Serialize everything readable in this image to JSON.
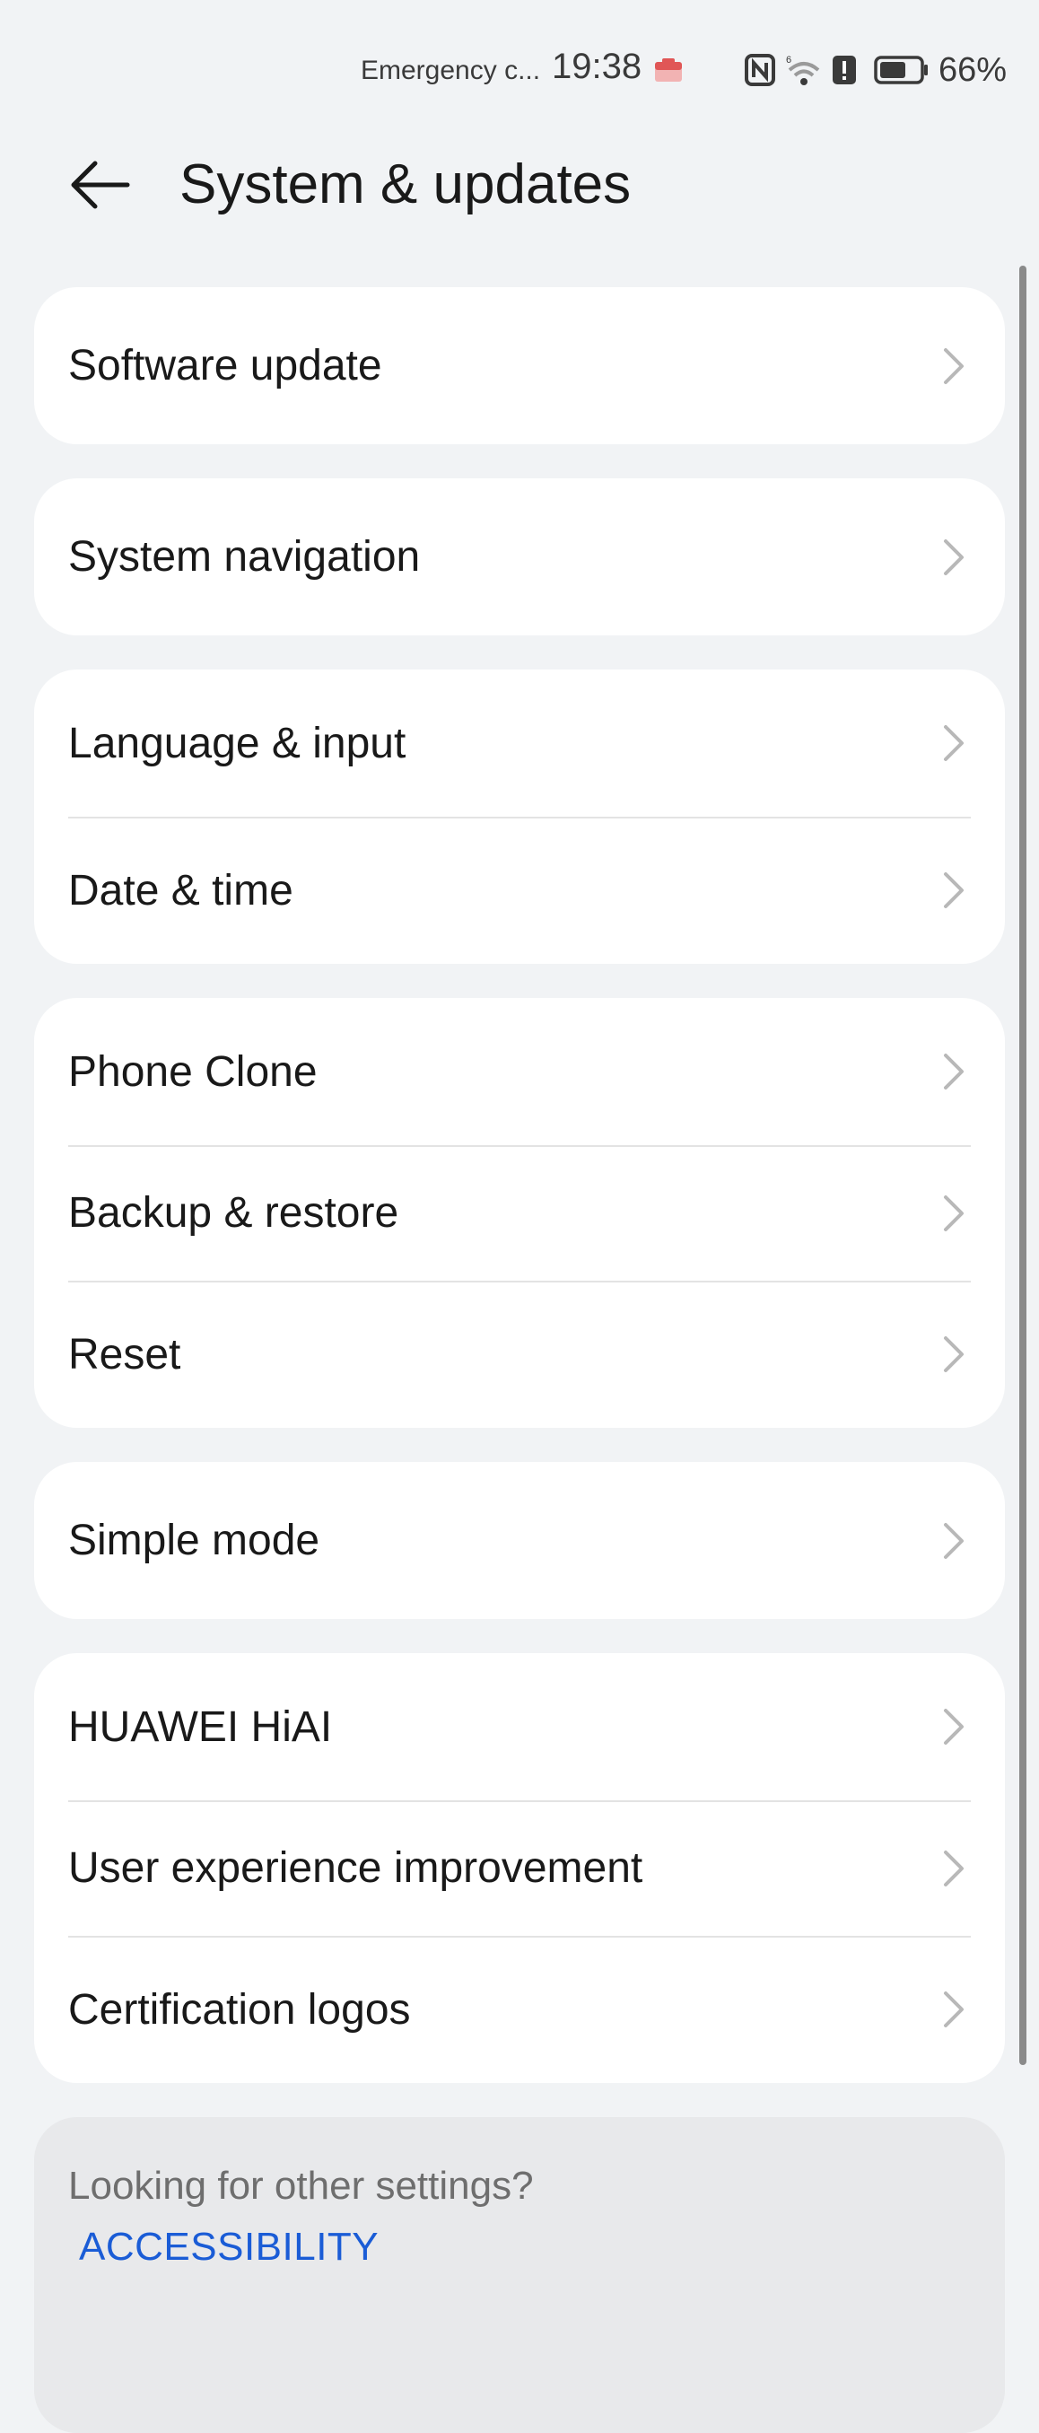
{
  "status_bar": {
    "carrier": "Emergency c...",
    "time": "19:38",
    "battery_percent": "66%",
    "icons": [
      "notification-app-icon",
      "nfc-icon",
      "wifi-icon",
      "alert-icon",
      "battery-icon"
    ],
    "battery_level": 0.66
  },
  "header": {
    "title": "System & updates",
    "back_icon": "back-arrow-icon"
  },
  "groups": [
    {
      "items": [
        {
          "label": "Software update"
        }
      ]
    },
    {
      "items": [
        {
          "label": "System navigation"
        }
      ]
    },
    {
      "items": [
        {
          "label": "Language & input"
        },
        {
          "label": "Date & time"
        }
      ]
    },
    {
      "items": [
        {
          "label": "Phone Clone"
        },
        {
          "label": "Backup & restore"
        },
        {
          "label": "Reset"
        }
      ]
    },
    {
      "items": [
        {
          "label": "Simple mode"
        }
      ]
    },
    {
      "items": [
        {
          "label": "HUAWEI HiAI"
        },
        {
          "label": "User experience improvement"
        },
        {
          "label": "Certification logos"
        }
      ]
    }
  ],
  "suggestions": {
    "title": "Looking for other settings?",
    "link": "ACCESSIBILITY"
  },
  "colors": {
    "background": "#f1f3f5",
    "card": "#ffffff",
    "link": "#1a5cd6",
    "chevron": "#b8b8b8"
  }
}
